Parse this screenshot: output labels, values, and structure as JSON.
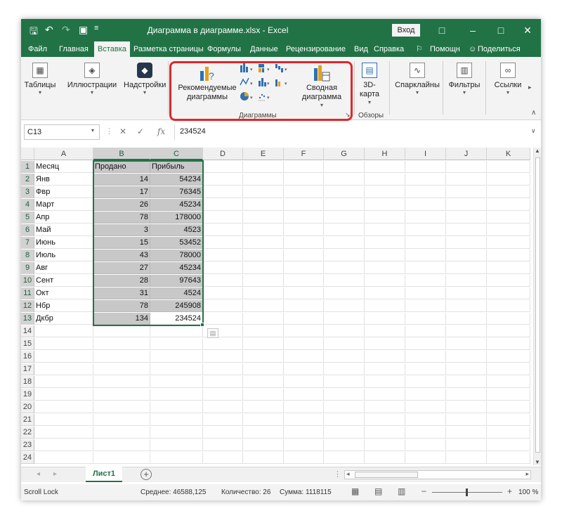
{
  "window": {
    "title": "Диаграмма в диаграмме.xlsx  -  Excel",
    "signin": "Вход",
    "colors": {
      "brand": "#217346",
      "highlight": "#e0272b",
      "selection": "#c8c8c8"
    }
  },
  "menu": {
    "tabs": [
      "Файл",
      "Главная",
      "Вставка",
      "Разметка страницы",
      "Формулы",
      "Данные",
      "Рецензирование",
      "Вид",
      "Справка"
    ],
    "active_tab": "Вставка",
    "help": "Помощн",
    "share": "Поделиться"
  },
  "ribbon": {
    "tables": "Таблицы",
    "illustrations": "Иллюстрации",
    "addins": "Надстройки",
    "recommended_charts": "Рекомендуемые диаграммы",
    "pivot_chart": "Сводная диаграмма",
    "charts_group": "Диаграммы",
    "map_3d": "3D-карта",
    "tours_group": "Обзоры",
    "sparklines": "Спарклайны",
    "filters": "Фильтры",
    "links": "Ссылки"
  },
  "formula_bar": {
    "cell_ref": "C13",
    "fx": "fx",
    "value": "234524"
  },
  "grid": {
    "columns": [
      "A",
      "B",
      "C",
      "D",
      "E",
      "F",
      "G",
      "H",
      "I",
      "J",
      "K"
    ],
    "rows": [
      "1",
      "2",
      "3",
      "4",
      "5",
      "6",
      "7",
      "8",
      "9",
      "10",
      "11",
      "12",
      "13",
      "14",
      "15",
      "16",
      "17",
      "18",
      "19",
      "20",
      "21",
      "22",
      "23",
      "24"
    ],
    "header": [
      "Месяц",
      "Продано",
      "Прибыль"
    ],
    "data": [
      [
        "Янв",
        "14",
        "54234"
      ],
      [
        "Фвр",
        "17",
        "76345"
      ],
      [
        "Март",
        "26",
        "45234"
      ],
      [
        "Апр",
        "78",
        "178000"
      ],
      [
        "Май",
        "3",
        "4523"
      ],
      [
        "Июнь",
        "15",
        "53452"
      ],
      [
        "Июль",
        "43",
        "78000"
      ],
      [
        "Авг",
        "27",
        "45234"
      ],
      [
        "Сент",
        "28",
        "97643"
      ],
      [
        "Окт",
        "31",
        "4524"
      ],
      [
        "Нбр",
        "78",
        "245908"
      ],
      [
        "Дкбр",
        "134",
        "234524"
      ]
    ]
  },
  "sheets": {
    "active": "Лист1",
    "add": "+"
  },
  "status": {
    "scroll_lock": "Scroll Lock",
    "average": "Среднее: 46588,125",
    "count": "Количество: 26",
    "sum": "Сумма: 1118115",
    "zoom": "100 %"
  }
}
